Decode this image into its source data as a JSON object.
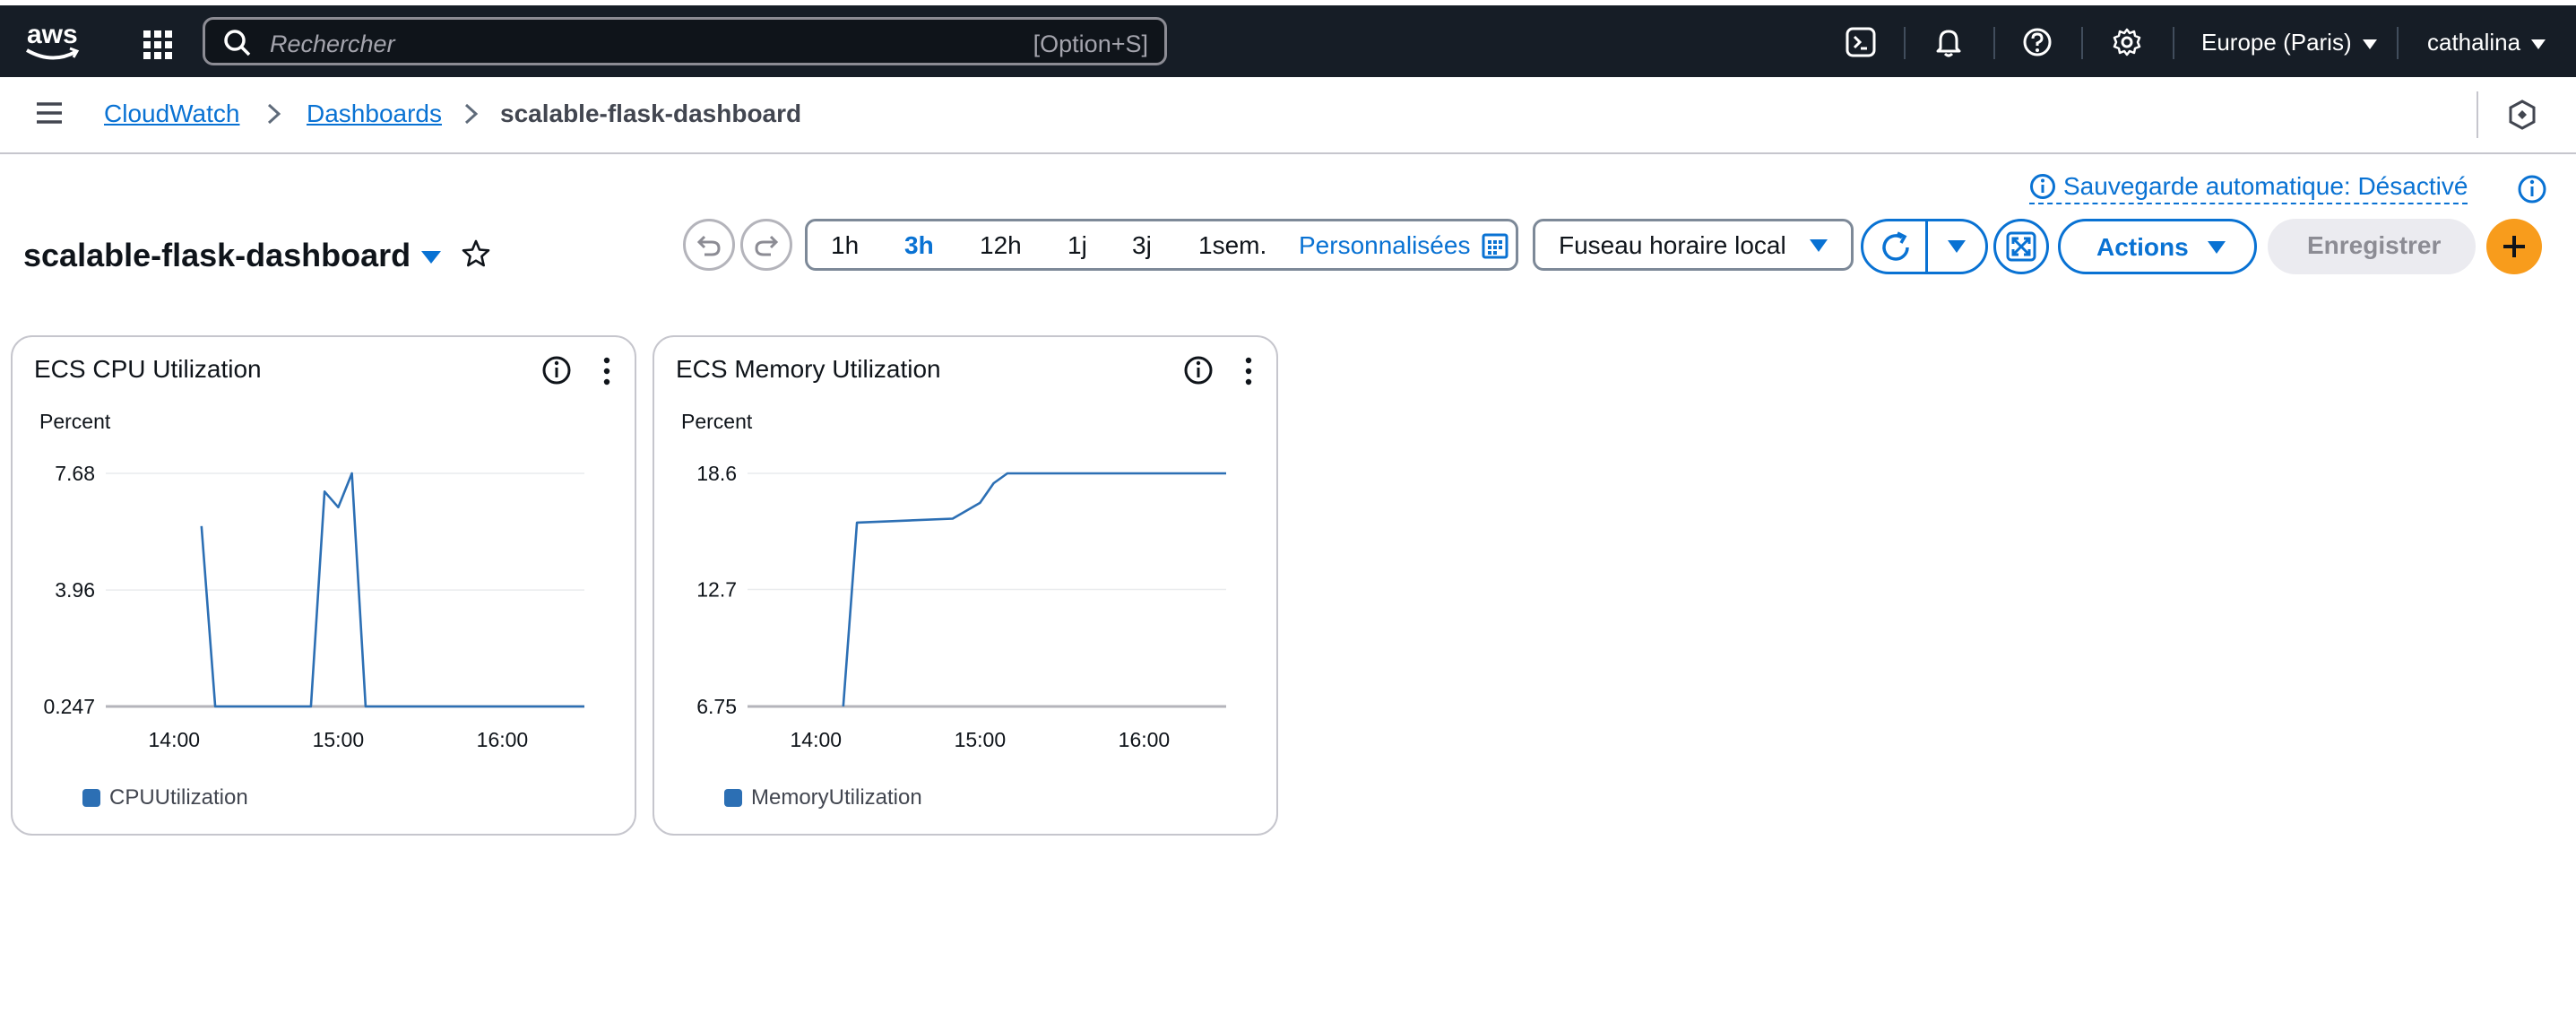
{
  "topbar": {
    "logo_text": "aws",
    "search_placeholder": "Rechercher",
    "search_shortcut": "[Option+S]",
    "region": "Europe (Paris)",
    "user": "cathalina"
  },
  "breadcrumbs": {
    "items": [
      "CloudWatch",
      "Dashboards"
    ],
    "current": "scalable-flask-dashboard"
  },
  "autosave_label": "Sauvegarde automatique: Désactivé",
  "dashboard": {
    "title": "scalable-flask-dashboard"
  },
  "time_ranges": [
    "1h",
    "3h",
    "12h",
    "1j",
    "3j",
    "1sem."
  ],
  "time_selected": "3h",
  "custom_label": "Personnalisées",
  "timezone_label": "Fuseau horaire local",
  "actions_label": "Actions",
  "save_label": "Enregistrer",
  "colors": {
    "accent": "#0972d3",
    "series": "#2c6fb4",
    "topbar": "#161d26",
    "plus": "#f89c1c"
  },
  "widgets": [
    {
      "title": "ECS CPU Utilization",
      "unit": "Percent",
      "y_ticks": [
        "7.68",
        "3.96",
        "0.247"
      ],
      "x_ticks": [
        "14:00",
        "15:00",
        "16:00"
      ],
      "legend": "CPUUtilization"
    },
    {
      "title": "ECS Memory Utilization",
      "unit": "Percent",
      "y_ticks": [
        "18.6",
        "12.7",
        "6.75"
      ],
      "x_ticks": [
        "14:00",
        "15:00",
        "16:00"
      ],
      "legend": "MemoryUtilization"
    }
  ],
  "chart_data": [
    {
      "type": "line",
      "title": "ECS CPU Utilization",
      "ylabel": "Percent",
      "ylim": [
        0.247,
        7.68
      ],
      "xlim": [
        "13:35",
        "16:30"
      ],
      "x_ticks": [
        "14:00",
        "15:00",
        "16:00"
      ],
      "series": [
        {
          "name": "CPUUtilization",
          "x": [
            "14:10",
            "14:15",
            "14:50",
            "14:55",
            "15:00",
            "15:05",
            "15:10",
            "16:30"
          ],
          "values": [
            6.0,
            0.247,
            0.247,
            7.1,
            6.6,
            7.68,
            0.247,
            0.247
          ]
        }
      ]
    },
    {
      "type": "line",
      "title": "ECS Memory Utilization",
      "ylabel": "Percent",
      "ylim": [
        6.75,
        18.6
      ],
      "xlim": [
        "13:35",
        "16:30"
      ],
      "x_ticks": [
        "14:00",
        "15:00",
        "16:00"
      ],
      "series": [
        {
          "name": "MemoryUtilization",
          "x": [
            "14:10",
            "14:15",
            "14:50",
            "15:00",
            "15:05",
            "15:10",
            "16:30"
          ],
          "values": [
            6.75,
            16.1,
            16.3,
            17.1,
            18.1,
            18.6,
            18.6
          ]
        }
      ]
    }
  ]
}
